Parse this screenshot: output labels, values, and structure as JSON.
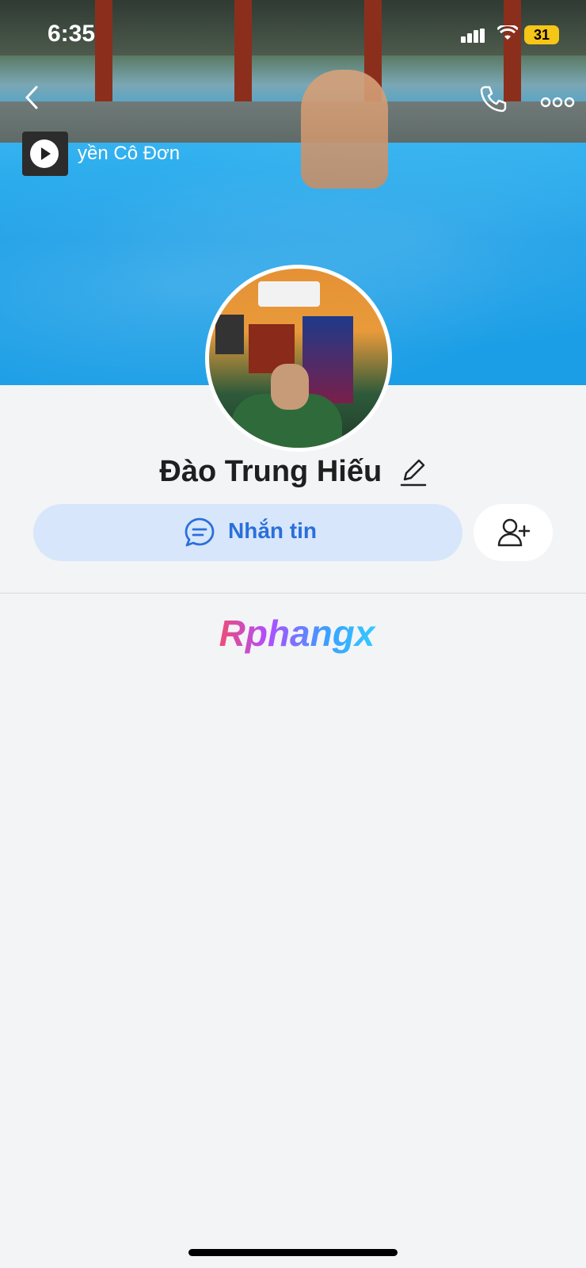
{
  "status_bar": {
    "time": "6:35",
    "battery": "31"
  },
  "cover": {
    "music_title": "yền Cô Đơn"
  },
  "profile": {
    "name": "Đào Trung Hiếu"
  },
  "actions": {
    "message_label": "Nhắn tin"
  },
  "watermark": {
    "text": "Rphangx"
  },
  "colors": {
    "accent": "#2a6fdb",
    "message_button_bg": "#d7e6fb",
    "battery": "#f5c518"
  }
}
